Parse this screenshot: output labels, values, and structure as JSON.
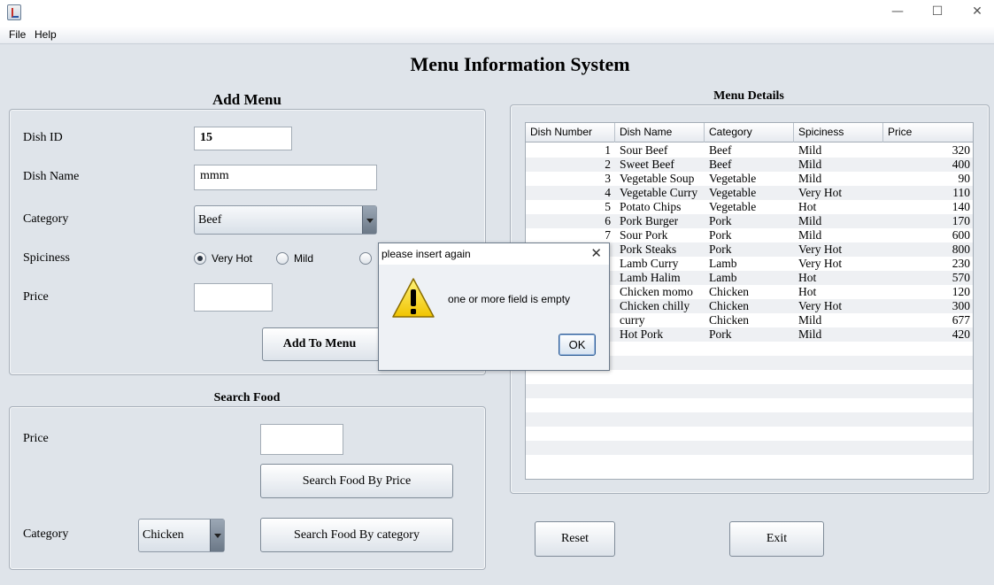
{
  "window": {
    "minimize": "—",
    "maximize": "☐",
    "close": "✕"
  },
  "menubar": {
    "file": "File",
    "help": "Help"
  },
  "app_title": "Menu Information System",
  "add_menu": {
    "title": "Add Menu",
    "dish_id_label": "Dish ID",
    "dish_id_value": "15",
    "dish_name_label": "Dish Name",
    "dish_name_value": "mmm",
    "category_label": "Category",
    "category_value": "Beef",
    "spiciness_label": "Spiciness",
    "spiciness_options": [
      "Very Hot",
      "Mild"
    ],
    "spiciness_selected": "Very Hot",
    "price_label": "Price",
    "price_value": "",
    "add_button": "Add To Menu"
  },
  "search_food": {
    "title": "Search Food",
    "price_label": "Price",
    "price_value": "",
    "search_price_button": "Search Food By Price",
    "category_label": "Category",
    "category_value": "Chicken",
    "search_category_button": "Search Food By category"
  },
  "menu_details": {
    "title": "Menu Details",
    "columns": [
      "Dish Number",
      "Dish Name",
      "Category",
      "Spiciness",
      "Price"
    ],
    "rows": [
      [
        "1",
        "Sour Beef",
        "Beef",
        "Mild",
        "320"
      ],
      [
        "2",
        "Sweet Beef",
        "Beef",
        "Mild",
        "400"
      ],
      [
        "3",
        "Vegetable Soup",
        "Vegetable",
        "Mild",
        "90"
      ],
      [
        "4",
        "Vegetable Curry",
        "Vegetable",
        "Very Hot",
        "110"
      ],
      [
        "5",
        "Potato Chips",
        "Vegetable",
        "Hot",
        "140"
      ],
      [
        "6",
        "Pork Burger",
        "Pork",
        "Mild",
        "170"
      ],
      [
        "7",
        "Sour Pork",
        "Pork",
        "Mild",
        "600"
      ],
      [
        "",
        "Pork Steaks",
        "Pork",
        "Very Hot",
        "800"
      ],
      [
        "",
        "Lamb Curry",
        "Lamb",
        "Very Hot",
        "230"
      ],
      [
        "",
        "Lamb Halim",
        "Lamb",
        "Hot",
        "570"
      ],
      [
        "",
        "Chicken momo",
        "Chicken",
        "Hot",
        "120"
      ],
      [
        "",
        "Chicken chilly",
        "Chicken",
        "Very Hot",
        "300"
      ],
      [
        "",
        "curry",
        "Chicken",
        "Mild",
        "677"
      ],
      [
        "",
        "Hot Pork",
        "Pork",
        "Mild",
        "420"
      ]
    ],
    "empty_rows": 8
  },
  "buttons": {
    "reset": "Reset",
    "exit": "Exit"
  },
  "dialog": {
    "title": "please insert again",
    "message": "one or more field is empty",
    "ok": "OK",
    "close": "✕"
  }
}
